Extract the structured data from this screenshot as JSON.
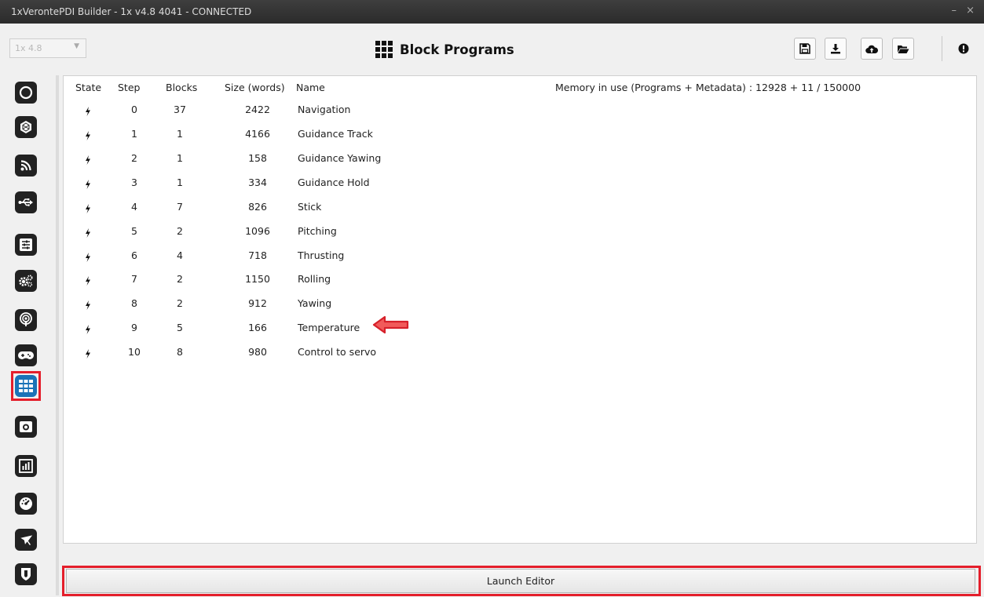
{
  "window": {
    "title": "1xVerontePDI Builder - 1x v4.8 4041 - CONNECTED",
    "controls": "– ×"
  },
  "header": {
    "version_select": "1x 4.8",
    "page_title": "Block Programs",
    "toolbar_icons": [
      "save-icon",
      "download-icon",
      "cloud-upload-icon",
      "folder-open-icon",
      "info-icon"
    ]
  },
  "sidebar": {
    "items": [
      {
        "icon": "connection-ring-icon"
      },
      {
        "icon": "hexagon-icon"
      },
      {
        "icon": "rss-feed-icon"
      },
      {
        "icon": "usb-icon"
      },
      {
        "icon": "sliders-icon"
      },
      {
        "icon": "cogs-icon"
      },
      {
        "icon": "podcast-icon"
      },
      {
        "icon": "gamepad-icon"
      },
      {
        "icon": "block-grid-icon",
        "active": true
      },
      {
        "icon": "camera-icon"
      },
      {
        "icon": "bar-chart-icon"
      },
      {
        "icon": "gauge-icon"
      },
      {
        "icon": "plane-icon"
      },
      {
        "icon": "shield-icon"
      }
    ]
  },
  "table": {
    "headers": {
      "state": "State",
      "step": "Step",
      "blocks": "Blocks",
      "size": "Size (words)",
      "name": "Name"
    },
    "memory_label": "Memory in use (Programs + Metadata) : 12928 + 11 / 150000",
    "rows": [
      {
        "step": "0",
        "blocks": "37",
        "size": "2422",
        "name": "Navigation"
      },
      {
        "step": "1",
        "blocks": "1",
        "size": "4166",
        "name": "Guidance Track"
      },
      {
        "step": "2",
        "blocks": "1",
        "size": "158",
        "name": "Guidance Yawing"
      },
      {
        "step": "3",
        "blocks": "1",
        "size": "334",
        "name": "Guidance Hold"
      },
      {
        "step": "4",
        "blocks": "7",
        "size": "826",
        "name": "Stick"
      },
      {
        "step": "5",
        "blocks": "2",
        "size": "1096",
        "name": "Pitching"
      },
      {
        "step": "6",
        "blocks": "4",
        "size": "718",
        "name": "Thrusting"
      },
      {
        "step": "7",
        "blocks": "2",
        "size": "1150",
        "name": "Rolling"
      },
      {
        "step": "8",
        "blocks": "2",
        "size": "912",
        "name": "Yawing"
      },
      {
        "step": "9",
        "blocks": "5",
        "size": "166",
        "name": "Temperature"
      },
      {
        "step": "10",
        "blocks": "8",
        "size": "980",
        "name": "Control to servo"
      }
    ],
    "state_icon": "bolt-icon"
  },
  "footer": {
    "launch_label": "Launch Editor"
  },
  "colors": {
    "accent": "#1a73b8",
    "highlight": "#e41e2b",
    "titlebar": "#2f2f2f"
  }
}
